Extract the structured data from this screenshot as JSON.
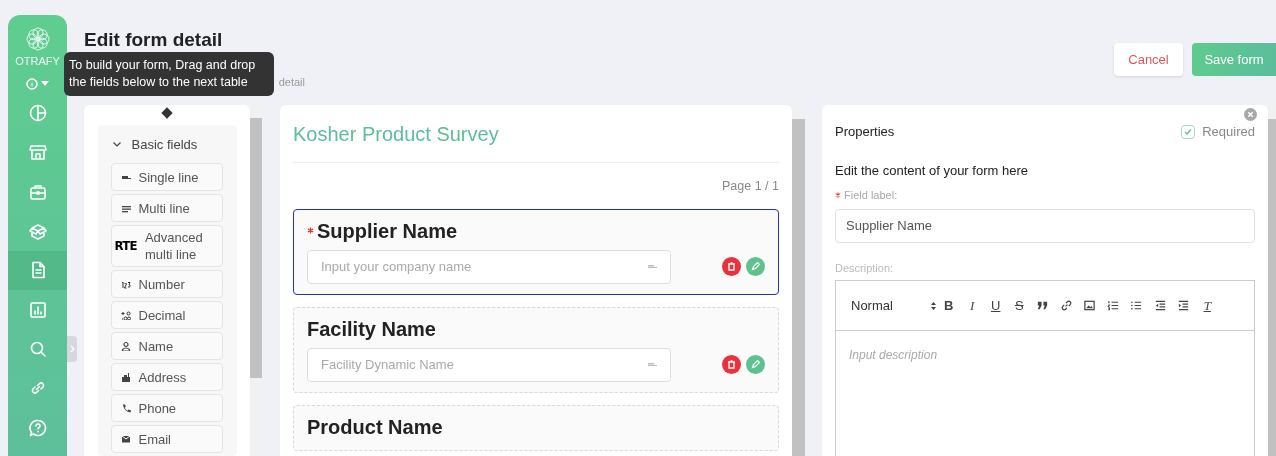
{
  "sidebar": {
    "brand": "OTRAFY",
    "items": [
      {
        "selected": false
      },
      {
        "selected": false
      },
      {
        "selected": false
      },
      {
        "selected": false
      },
      {
        "selected": true
      },
      {
        "selected": false
      },
      {
        "selected": false
      },
      {
        "selected": false
      },
      {
        "selected": false
      }
    ]
  },
  "header": {
    "title": "Edit form detail",
    "subtitle": "detail",
    "buttons": [
      {
        "label": "Cancel",
        "kind": "secondary"
      },
      {
        "label": "Save form",
        "kind": "primary"
      }
    ]
  },
  "tooltip": {
    "text": "To build your form, Drag and drop the fields below to the next table"
  },
  "palette": {
    "section": {
      "title": "Basic fields",
      "expanded": true
    },
    "items": [
      {
        "label": "Single line",
        "kind": "single"
      },
      {
        "label": "Multi line",
        "kind": "multi"
      },
      {
        "label": "Advanced multi line",
        "kind": "text",
        "badge": "RTE"
      },
      {
        "label": "Number",
        "kind": "number"
      },
      {
        "label": "Decimal",
        "kind": "decimal"
      },
      {
        "label": "Name",
        "kind": "person"
      },
      {
        "label": "Address",
        "kind": "building"
      },
      {
        "label": "Phone",
        "kind": "phone"
      },
      {
        "label": "Email",
        "kind": "mail"
      }
    ]
  },
  "form": {
    "title": "Kosher Product Survey",
    "page": "Page 1 / 1",
    "fields": [
      {
        "label": "Supplier Name",
        "required": true,
        "selected": true,
        "placeholder": "Input your company name"
      },
      {
        "label": "Facility Name",
        "required": false,
        "selected": false,
        "placeholder": "Facility Dynamic Name"
      },
      {
        "label": "Product Name",
        "required": false,
        "selected": false
      }
    ]
  },
  "properties": {
    "title": "Properties",
    "required": {
      "label": "Required",
      "checked": true
    },
    "heading": "Edit the content of your form here",
    "field_label": {
      "label": "Field label:",
      "required": true,
      "value": "Supplier Name"
    },
    "description": {
      "label": "Description:",
      "format": "Normal",
      "placeholder": "Input description",
      "toolbar": [
        {
          "kind": "bold",
          "label": "B"
        },
        {
          "kind": "italic",
          "label": "I"
        },
        {
          "kind": "underline",
          "label": "U"
        },
        {
          "kind": "strike",
          "label": "S"
        },
        {
          "kind": "quote"
        },
        {
          "kind": "link"
        },
        {
          "kind": "image"
        },
        {
          "kind": "ol"
        },
        {
          "kind": "ul"
        },
        {
          "kind": "outdent"
        },
        {
          "kind": "indent"
        },
        {
          "kind": "clear",
          "label": "T"
        }
      ]
    }
  }
}
